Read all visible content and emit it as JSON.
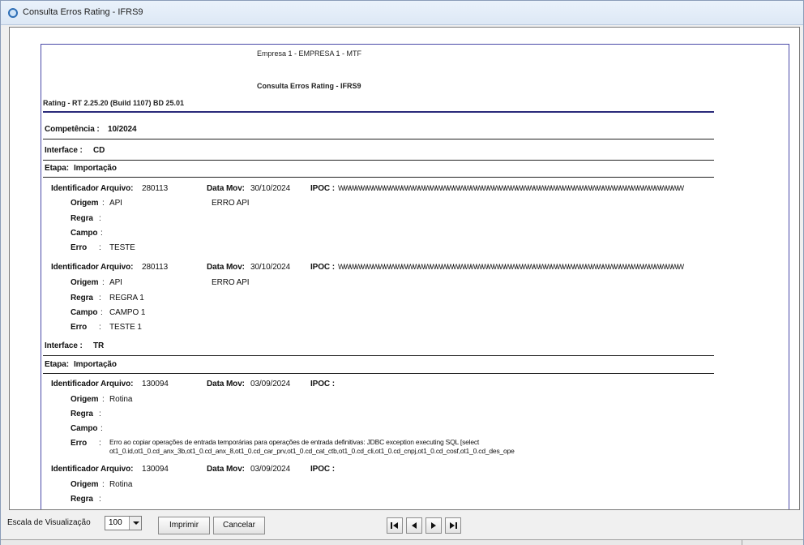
{
  "window": {
    "title": "Consulta Erros Rating - IFRS9"
  },
  "report": {
    "company": "Empresa  1 - EMPRESA 1 - MTF",
    "title": "Consulta Erros Rating - IFRS9",
    "version": "Rating - RT 2.25.20 (Build 1107) BD 25.01",
    "competencia_label": "Competência :",
    "competencia_value": "10/2024",
    "interface_label": "Interface :",
    "etapa_label": "Etapa:",
    "labels": {
      "identificador": "Identificador Arquivo:",
      "data_mov": "Data Mov:",
      "ipoc": "IPOC :",
      "origem": "Origem",
      "regra": "Regra",
      "campo": "Campo",
      "erro": "Erro"
    },
    "interfaces": [
      {
        "name": "CD",
        "etapa": "Importação",
        "records": [
          {
            "id": "280113",
            "data_mov": "30/10/2024",
            "ipoc": "WWWWWWWWWWWWWWWWWWWWWWWWWWWWWWWWWWWWWWWWWWWWWWWWWWWWWWWWWWWW",
            "origem": "API",
            "origem_desc": "ERRO API",
            "regra": "",
            "campo": "",
            "erro": "TESTE"
          },
          {
            "id": "280113",
            "data_mov": "30/10/2024",
            "ipoc": "WWWWWWWWWWWWWWWWWWWWWWWWWWWWWWWWWWWWWWWWWWWWWWWWWWWWWWWWWWWW",
            "origem": "API",
            "origem_desc": "ERRO API",
            "regra": "REGRA 1",
            "campo": "CAMPO 1",
            "erro": "TESTE 1"
          }
        ]
      },
      {
        "name": "TR",
        "etapa": "Importação",
        "records": [
          {
            "id": "130094",
            "data_mov": "03/09/2024",
            "ipoc": "",
            "origem": "Rotina",
            "regra": "",
            "campo": "",
            "erro_line1": "Erro ao copiar operações de entrada temporárias para operações de entrada definitivas: JDBC exception executing SQL [select",
            "erro_line2": "ot1_0.id,ot1_0.cd_anx_3b,ot1_0.cd_anx_8,ot1_0.cd_car_prv,ot1_0.cd_cat_ctb,ot1_0.cd_cli,ot1_0.cd_cnpj,ot1_0.cd_cosf,ot1_0.cd_des_ope"
          },
          {
            "id": "130094",
            "data_mov": "03/09/2024",
            "ipoc": "",
            "origem": "Rotina",
            "regra": ""
          }
        ]
      }
    ]
  },
  "toolbar": {
    "scale_label": "Escala de Visualização",
    "scale_value": "100",
    "print_label": "Imprimir",
    "cancel_label": "Cancelar"
  },
  "icons": {
    "first": "first-page-icon",
    "prev": "previous-page-icon",
    "next": "next-page-icon",
    "last": "last-page-icon"
  }
}
